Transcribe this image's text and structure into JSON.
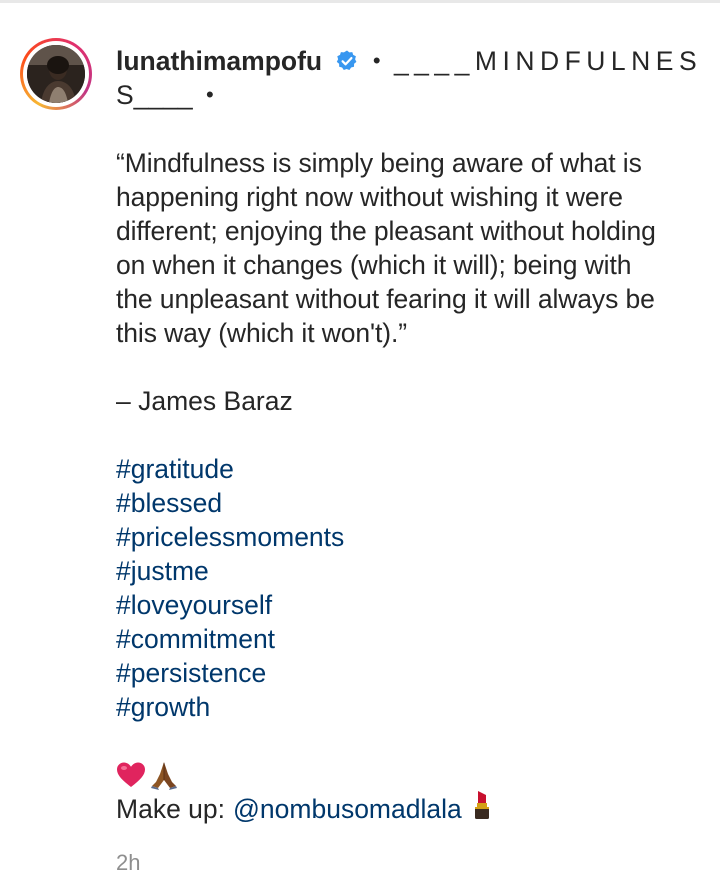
{
  "post": {
    "username": "lunathimampofu",
    "verified": true,
    "separator": "•",
    "title_line1": "____MINDFULNES",
    "title_line2": "S____",
    "title_line2_dot": "•",
    "quote_lines": [
      "“Mindfulness is simply being aware of what is",
      "happening right now without wishing it were",
      "different; enjoying the pleasant without holding",
      "on when it changes (which it will); being with",
      "the unpleasant without fearing it will always be",
      "this way (which it won't).”"
    ],
    "attribution": "– James Baraz",
    "hashtags": [
      "#gratitude",
      "#blessed",
      "#pricelessmoments",
      "#justme",
      "#loveyourself",
      "#commitment",
      "#persistence",
      "#growth"
    ],
    "emojis": [
      "heart-emoji",
      "praying-hands-emoji"
    ],
    "makeup_label": "Make up:",
    "makeup_mention": "@nombusomadlala",
    "timestamp": "2h"
  },
  "colors": {
    "text": "#262626",
    "link": "#00376b",
    "muted": "#8e8e8e",
    "verified_badge": "#3897f0",
    "heart": "#e0245e"
  }
}
